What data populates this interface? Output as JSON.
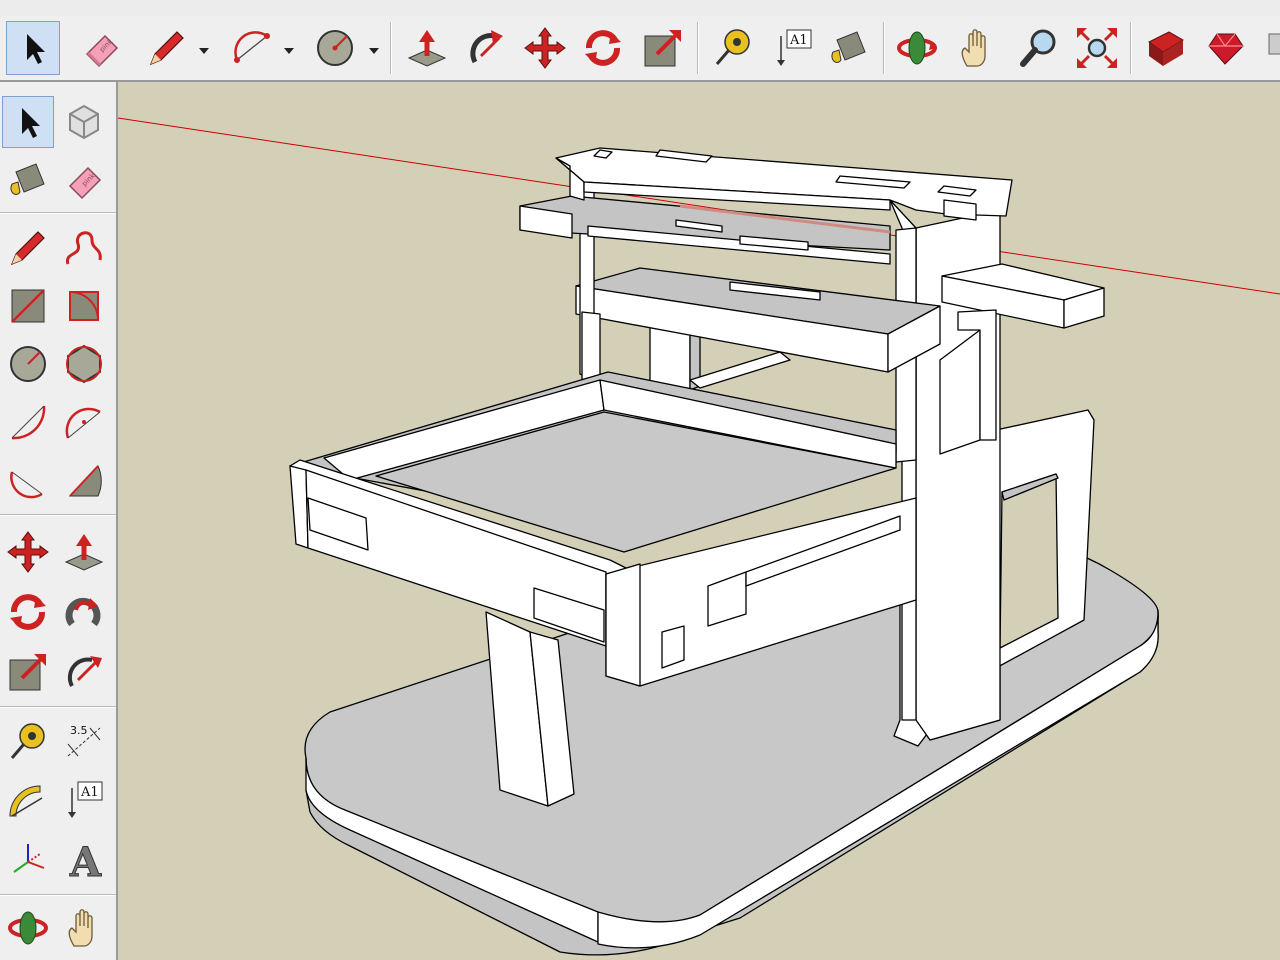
{
  "colors": {
    "viewport_bg": "#d4d0b8",
    "toolbar_bg": "#efefef",
    "model_face": "#ffffff",
    "model_shade": "#c4c4c4",
    "edge": "#000000",
    "red_axis": "#cc0000",
    "selected_tool_bg": "#cfe0f4"
  },
  "top_toolbar": {
    "tools": [
      {
        "name": "select",
        "icon": "arrow-cursor-icon",
        "selected": true
      },
      {
        "name": "eraser",
        "icon": "eraser-icon",
        "text": "pink"
      },
      {
        "name": "pencil",
        "icon": "pencil-icon"
      },
      {
        "name": "arc",
        "icon": "arc-icon"
      },
      {
        "name": "circle",
        "icon": "circle-icon"
      },
      {
        "name": "push-pull",
        "icon": "push-pull-icon"
      },
      {
        "name": "follow-me",
        "icon": "follow-me-icon"
      },
      {
        "name": "move",
        "icon": "move-icon"
      },
      {
        "name": "rotate",
        "icon": "rotate-icon"
      },
      {
        "name": "scale",
        "icon": "scale-icon"
      },
      {
        "name": "tape-measure",
        "icon": "tape-measure-icon"
      },
      {
        "name": "text",
        "icon": "text-label-icon",
        "text": "A1"
      },
      {
        "name": "paint-bucket",
        "icon": "paint-bucket-icon"
      },
      {
        "name": "orbit",
        "icon": "orbit-icon"
      },
      {
        "name": "pan",
        "icon": "pan-hand-icon"
      },
      {
        "name": "zoom",
        "icon": "zoom-icon"
      },
      {
        "name": "zoom-extents",
        "icon": "zoom-extents-icon"
      },
      {
        "name": "3d-warehouse",
        "icon": "warehouse-icon"
      },
      {
        "name": "extension-warehouse",
        "icon": "ruby-icon"
      }
    ]
  },
  "left_toolbar": {
    "tools": [
      {
        "name": "select",
        "icon": "arrow-cursor-icon",
        "selected": true
      },
      {
        "name": "make-component",
        "icon": "component-icon"
      },
      {
        "name": "paint-bucket",
        "icon": "paint-bucket-icon"
      },
      {
        "name": "eraser",
        "icon": "eraser-icon",
        "text": "pink"
      },
      {
        "name": "line",
        "icon": "pencil-icon"
      },
      {
        "name": "freehand",
        "icon": "freehand-icon"
      },
      {
        "name": "rectangle",
        "icon": "rectangle-icon"
      },
      {
        "name": "rotated-rectangle",
        "icon": "rotated-rectangle-icon"
      },
      {
        "name": "circle",
        "icon": "circle-icon"
      },
      {
        "name": "polygon",
        "icon": "polygon-icon"
      },
      {
        "name": "arc",
        "icon": "arc-icon"
      },
      {
        "name": "two-point-arc",
        "icon": "two-point-arc-icon"
      },
      {
        "name": "three-point-arc",
        "icon": "three-point-arc-icon"
      },
      {
        "name": "pie",
        "icon": "pie-icon"
      },
      {
        "name": "move",
        "icon": "move-icon"
      },
      {
        "name": "push-pull",
        "icon": "push-pull-icon"
      },
      {
        "name": "rotate",
        "icon": "rotate-icon"
      },
      {
        "name": "follow-me",
        "icon": "follow-me-icon"
      },
      {
        "name": "scale",
        "icon": "scale-icon"
      },
      {
        "name": "offset",
        "icon": "offset-icon"
      },
      {
        "name": "tape-measure",
        "icon": "tape-measure-icon"
      },
      {
        "name": "dimensions",
        "icon": "dimension-icon",
        "text": "3.5"
      },
      {
        "name": "protractor",
        "icon": "protractor-icon"
      },
      {
        "name": "text",
        "icon": "text-label-icon",
        "text": "A1"
      },
      {
        "name": "axes",
        "icon": "axes-icon"
      },
      {
        "name": "3d-text",
        "icon": "3d-text-icon",
        "text": "A"
      },
      {
        "name": "orbit",
        "icon": "orbit-icon"
      },
      {
        "name": "pan",
        "icon": "pan-hand-icon"
      }
    ]
  }
}
